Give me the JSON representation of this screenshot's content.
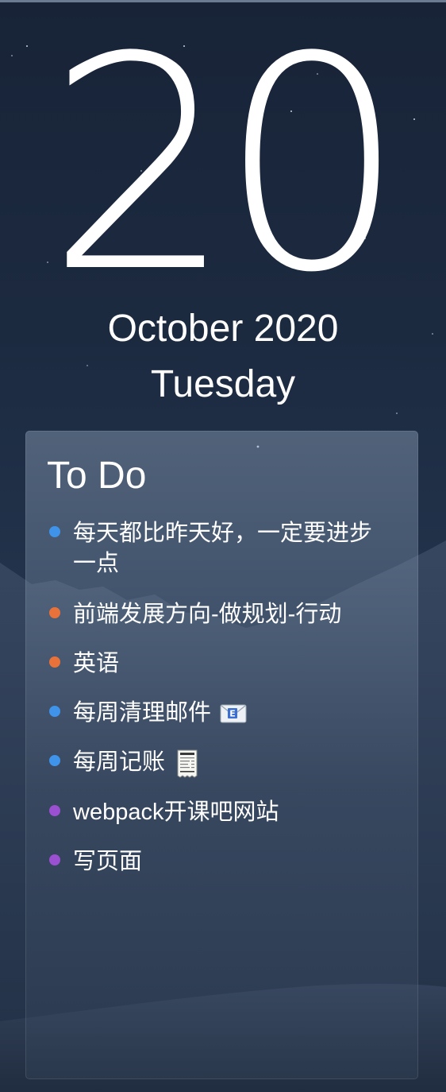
{
  "date": {
    "day": "20",
    "month_year": "October 2020",
    "weekday": "Tuesday"
  },
  "todo": {
    "title": "To Do",
    "items": [
      {
        "text": "每天都比昨天好，一定要进步一点",
        "dot_color": "#3f93e8",
        "icon": ""
      },
      {
        "text": "前端发展方向-做规划-行动",
        "dot_color": "#e8723a",
        "icon": ""
      },
      {
        "text": "英语",
        "dot_color": "#e8723a",
        "icon": ""
      },
      {
        "text": "每周清理邮件",
        "dot_color": "#3f93e8",
        "icon": "envelope-icon"
      },
      {
        "text": "每周记账",
        "dot_color": "#3f93e8",
        "icon": "receipt-icon"
      },
      {
        "text": "webpack开课吧网站",
        "dot_color": "#9b4fd1",
        "icon": ""
      },
      {
        "text": "写页面",
        "dot_color": "#9b4fd1",
        "icon": ""
      }
    ]
  }
}
